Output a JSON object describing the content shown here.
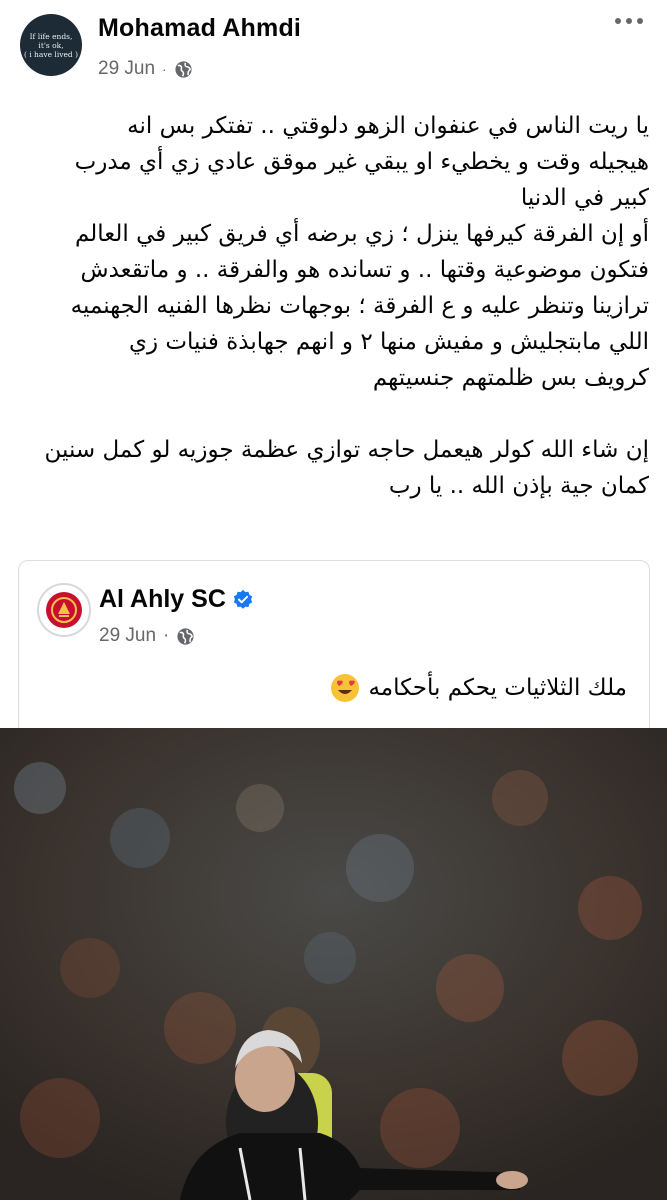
{
  "post": {
    "author": "Mohamad Ahmdi",
    "avatar_text": [
      "If life ends,",
      "it's ok,",
      "( i have lived )"
    ],
    "date": "29 Jun",
    "dot": "·",
    "privacy_icon": "globe-icon",
    "text_lines": [
      "يا ريت الناس في عنفوان الزهو دلوقتي .. تفتكر بس انه",
      "هيجيله وقت و يخطيء او يبقي غير موقق عادي زي أي مدرب",
      "كبير في الدنيا",
      "أو إن الفرقة كيرفها ينزل ؛ زي برضه أي فريق كبير في العالم",
      "فتكون موضوعية وقتها .. و تسانده هو والفرقة .. و ماتقعدش",
      "ترازينا وتنظر عليه و ع الفرقة ؛ بوجهات نظرها الفنيه الجهنميه",
      "اللي مابتجليش و مفيش منها ٢ و انهم جهابذة فنيات زي",
      "كرويف بس ظلمتهم جنسيتهم",
      "",
      "إن شاء الله كولر هيعمل حاجه توازي عظمة جوزيه لو كمل سنين",
      "كمان جية بإذن الله .. يا رب"
    ]
  },
  "shared": {
    "page_name": "Al Ahly SC",
    "verified_icon": "verified-badge-icon",
    "date": "29 Jun",
    "dot": "·",
    "privacy_icon": "globe-icon",
    "text": "ملك الثلاثيات يحكم بأحكامه",
    "emoji": "heart-eyes-emoji-icon"
  },
  "colors": {
    "meta_gray": "#65676b",
    "verified_blue": "#1877f2",
    "ahly_red": "#c8102e"
  }
}
